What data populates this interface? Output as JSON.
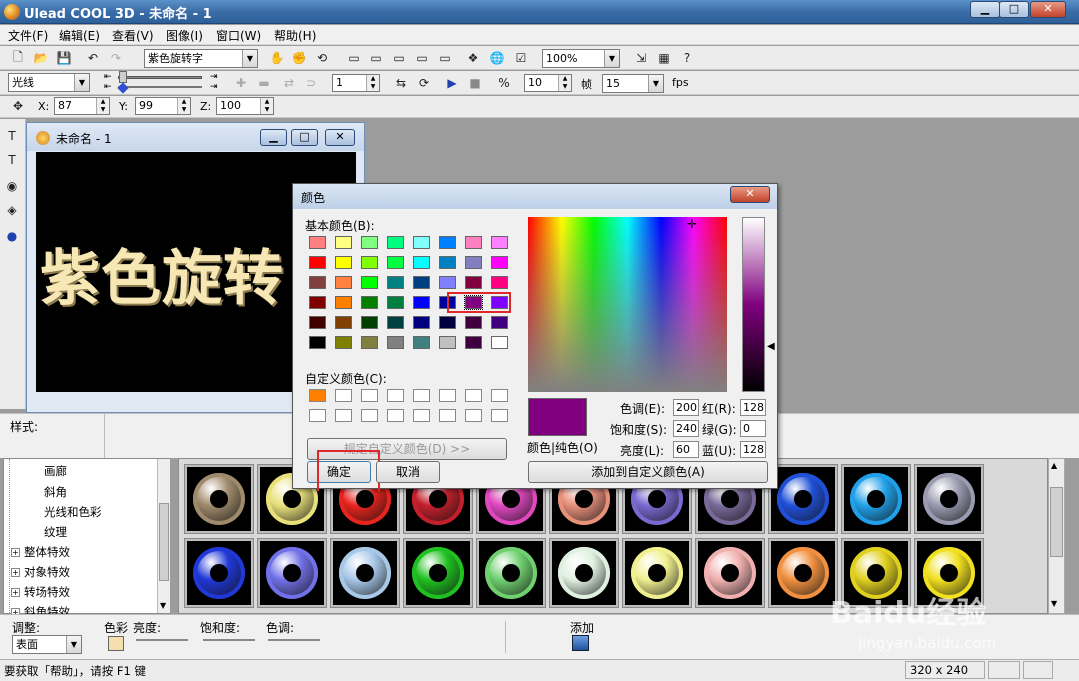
{
  "window": {
    "title": "Ulead COOL 3D - 未命名 - 1"
  },
  "menubar": [
    "文件(F)",
    "编辑(E)",
    "查看(V)",
    "图像(I)",
    "窗口(W)",
    "帮助(H)"
  ],
  "toolbar1": {
    "text_object": "紫色旋转字",
    "zoom": "100%"
  },
  "toolbar2": {
    "mode": "光线",
    "frame": "1",
    "frame_count": "10",
    "frame_label": "帧",
    "rate": "15",
    "rate_unit": "fps"
  },
  "toolbar3": {
    "x_label": "X:",
    "x": "87",
    "y_label": "Y:",
    "y": "99",
    "z_label": "Z:",
    "z": "100"
  },
  "document": {
    "title": "未命名 - 1",
    "canvas_text": "紫色旋转",
    "canvas_text_clipped": "转"
  },
  "style_label": "样式:",
  "tree": {
    "items": [
      {
        "label": "画廊",
        "expandable": false
      },
      {
        "label": "斜角",
        "expandable": false
      },
      {
        "label": "光线和色彩",
        "expandable": false
      },
      {
        "label": "纹理",
        "expandable": false
      },
      {
        "label": "整体特效",
        "expandable": true
      },
      {
        "label": "对象特效",
        "expandable": true
      },
      {
        "label": "转场特效",
        "expandable": true
      },
      {
        "label": "斜角特效",
        "expandable": true
      }
    ]
  },
  "gallery": {
    "row1": [
      "#a08a6c",
      "#e8e07a",
      "#e8241e",
      "#c4202c",
      "#e048c0",
      "#e8907a",
      "#7a6ad0",
      "#7a6a9a",
      "#2050d8",
      "#20a0e8",
      "#9a9ab0"
    ],
    "row2": [
      "#2038d8",
      "#7070e8",
      "#a8c8e8",
      "#20c020",
      "#70d070",
      "#e0f0e0",
      "#f0f090",
      "#f0b0b0",
      "#f09040",
      "#e0d020",
      "#f0e020"
    ]
  },
  "bottom": {
    "adjust_label": "调整:",
    "adjust_value": "表面",
    "color_label": "色彩",
    "brightness_label": "亮度:",
    "saturation_label": "饱和度:",
    "hue_label": "色调:",
    "add_label": "添加"
  },
  "status": {
    "hint": "要获取「帮助」，请按 F1 键",
    "size": "320 x 240"
  },
  "color_dialog": {
    "title": "颜色",
    "basic_label": "基本颜色(B):",
    "basic_colors": [
      [
        "#ff8080",
        "#ffff80",
        "#80ff80",
        "#00ff80",
        "#80ffff",
        "#0080ff",
        "#ff80c0",
        "#ff80ff"
      ],
      [
        "#ff0000",
        "#ffff00",
        "#80ff00",
        "#00ff40",
        "#00ffff",
        "#0080c0",
        "#8080c0",
        "#ff00ff"
      ],
      [
        "#804040",
        "#ff8040",
        "#00ff00",
        "#008080",
        "#004080",
        "#8080ff",
        "#800040",
        "#ff0080"
      ],
      [
        "#800000",
        "#ff8000",
        "#008000",
        "#008040",
        "#0000ff",
        "#0000a0",
        "#800080",
        "#8000ff"
      ],
      [
        "#400000",
        "#804000",
        "#004000",
        "#004040",
        "#000080",
        "#000040",
        "#400040",
        "#400080"
      ],
      [
        "#000000",
        "#808000",
        "#808040",
        "#808080",
        "#408080",
        "#c0c0c0",
        "#400040",
        "#ffffff"
      ]
    ],
    "custom_label": "自定义颜色(C):",
    "custom_first": "#ff8000",
    "define_button": "规定自定义颜色(D) >>",
    "ok_button": "确定",
    "cancel_button": "取消",
    "add_custom_button": "添加到自定义颜色(A)",
    "preview_label": "颜色|纯色(O)",
    "selected_color": "#800080",
    "hue_label": "色调(E):",
    "hue": "200",
    "sat_label": "饱和度(S):",
    "sat": "240",
    "lum_label": "亮度(L):",
    "lum": "60",
    "red_label": "红(R):",
    "red": "128",
    "green_label": "绿(G):",
    "green": "0",
    "blue_label": "蓝(U):",
    "blue": "128"
  },
  "watermark": {
    "brand": "Baidu经验",
    "url": "jingyan.baidu.com"
  }
}
